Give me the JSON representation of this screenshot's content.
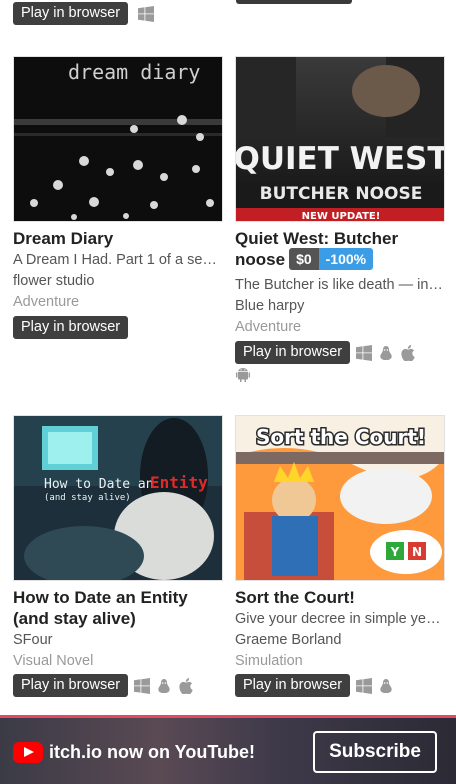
{
  "colors": {
    "button_bg": "#3f3f3f",
    "price_bg": "#545454",
    "discount_bg": "#3b9de5",
    "banner_border": "#e24a63",
    "youtube_red": "#ff0000"
  },
  "top": {
    "play_label": "Play in browser",
    "platforms": [
      "windows-icon"
    ]
  },
  "games": [
    {
      "title": "Dream Diary",
      "thumb_text": "dream diary",
      "description": "A Dream I Had. Part 1 of a se…",
      "author": "flower studio",
      "genre": "Adventure",
      "play_label": "Play in browser",
      "platforms": []
    },
    {
      "title_line1": "Quiet West: Butcher",
      "title_line2": "noose",
      "price": "$0",
      "discount": "-100%",
      "thumb_text_1": "QUIET WEST",
      "thumb_text_2": "BUTCHER NOOSE",
      "thumb_text_3": "NEW UPDATE!",
      "description": "The Butcher is like death — in…",
      "author": "Blue harpy",
      "genre": "Adventure",
      "play_label": "Play in browser",
      "platforms": [
        "windows-icon",
        "linux-icon",
        "apple-icon",
        "android-icon"
      ]
    },
    {
      "title_line1": "How to Date an Entity",
      "title_line2": "(and stay alive)",
      "thumb_text_1": "How to Date an",
      "thumb_text_2": "Entity",
      "thumb_text_3": "(and stay alive)",
      "author": "SFour",
      "genre": "Visual Novel",
      "play_label": "Play in browser",
      "platforms": [
        "windows-icon",
        "linux-icon",
        "apple-icon"
      ]
    },
    {
      "title": "Sort the Court!",
      "thumb_text": "Sort the Court!",
      "thumb_yes": "Y",
      "thumb_no": "N",
      "description": "Give your decree in simple ye…",
      "author": "Graeme Borland",
      "genre": "Simulation",
      "play_label": "Play in browser",
      "platforms": [
        "windows-icon",
        "linux-icon"
      ]
    }
  ],
  "banner": {
    "message": "itch.io now on YouTube!",
    "subscribe_label": "Subscribe"
  }
}
